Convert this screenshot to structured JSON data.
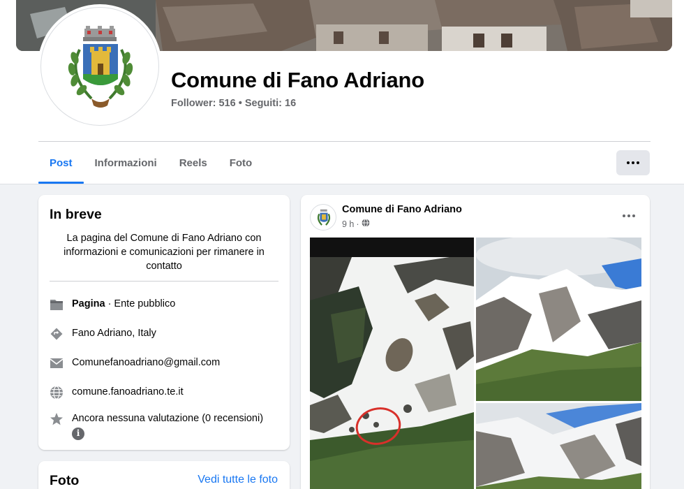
{
  "header": {
    "page_name": "Comune di Fano Adriano",
    "followers_label": "Follower:",
    "followers_count": "516",
    "separator": "•",
    "following_label": "Seguiti:",
    "following_count": "16",
    "avatar_icon": "coat-of-arms-icon",
    "cover_icon": "village-rooftops-photo"
  },
  "tabs": [
    {
      "label": "Post",
      "active": true
    },
    {
      "label": "Informazioni",
      "active": false
    },
    {
      "label": "Reels",
      "active": false
    },
    {
      "label": "Foto",
      "active": false
    }
  ],
  "more_button_icon": "more-horizontal-icon",
  "intro": {
    "title": "In breve",
    "bio": "La pagina del Comune di Fano Adriano con informazioni e comunicazioni per rimanere in contatto",
    "rows": [
      {
        "icon": "flag-icon",
        "bold": "Pagina",
        "text": " · Ente pubblico"
      },
      {
        "icon": "location-diamond-icon",
        "text": "Fano Adriano, Italy"
      },
      {
        "icon": "mail-icon",
        "text": "Comunefanoadriano@gmail.com"
      },
      {
        "icon": "globe-icon",
        "text": "comune.fanoadriano.te.it"
      },
      {
        "icon": "star-icon",
        "text": "Ancora nessuna valutazione (0 recensioni)",
        "extra_icon": "info-icon",
        "extra_glyph": "i"
      }
    ]
  },
  "photos": {
    "title": "Foto",
    "link": "Vedi tutte le foto"
  },
  "post": {
    "author": "Comune di Fano Adriano",
    "time": "9 h",
    "dot": "·",
    "audience_icon": "globe-icon",
    "more_icon": "more-horizontal-icon",
    "images": [
      "snowy-mountainside-photo",
      "snowy-peaks-photo",
      "mountain-valley-photo"
    ]
  },
  "colors": {
    "accent": "#1877f2",
    "background": "#f0f2f5",
    "secondary_text": "#65676b"
  }
}
